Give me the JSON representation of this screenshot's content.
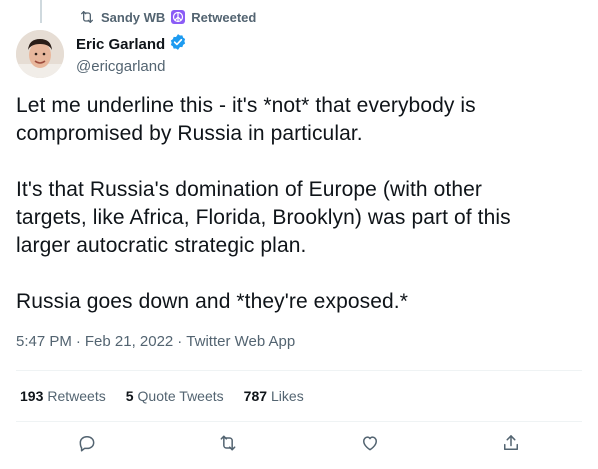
{
  "retweet": {
    "user": "Sandy WB",
    "label": "Retweeted"
  },
  "author": {
    "display_name": "Eric Garland",
    "handle": "@ericgarland"
  },
  "tweet": {
    "text": "Let me underline this - it's *not* that everybody is\ncompromised by Russia in particular.\n\nIt's that Russia's domination of Europe (with other\ntargets, like Africa, Florida, Brooklyn) was part of this\nlarger autocratic strategic plan.\n\nRussia goes down and *they're exposed.*"
  },
  "meta": {
    "time": "5:47 PM",
    "sep1": "·",
    "date": "Feb 21, 2022",
    "sep2": "·",
    "source": "Twitter Web App"
  },
  "stats": {
    "retweets_count": "193",
    "retweets_label": "Retweets",
    "quotes_count": "5",
    "quotes_label": "Quote Tweets",
    "likes_count": "787",
    "likes_label": "Likes"
  },
  "icons": {
    "retweet": "retweet-icon",
    "peace": "peace-icon",
    "verified": "verified-badge-icon",
    "reply": "reply-icon",
    "like": "like-icon",
    "share": "share-icon"
  },
  "colors": {
    "text": "#0f1419",
    "muted": "#536471",
    "verified": "#1d9bf0",
    "divider": "#eff3f4"
  }
}
